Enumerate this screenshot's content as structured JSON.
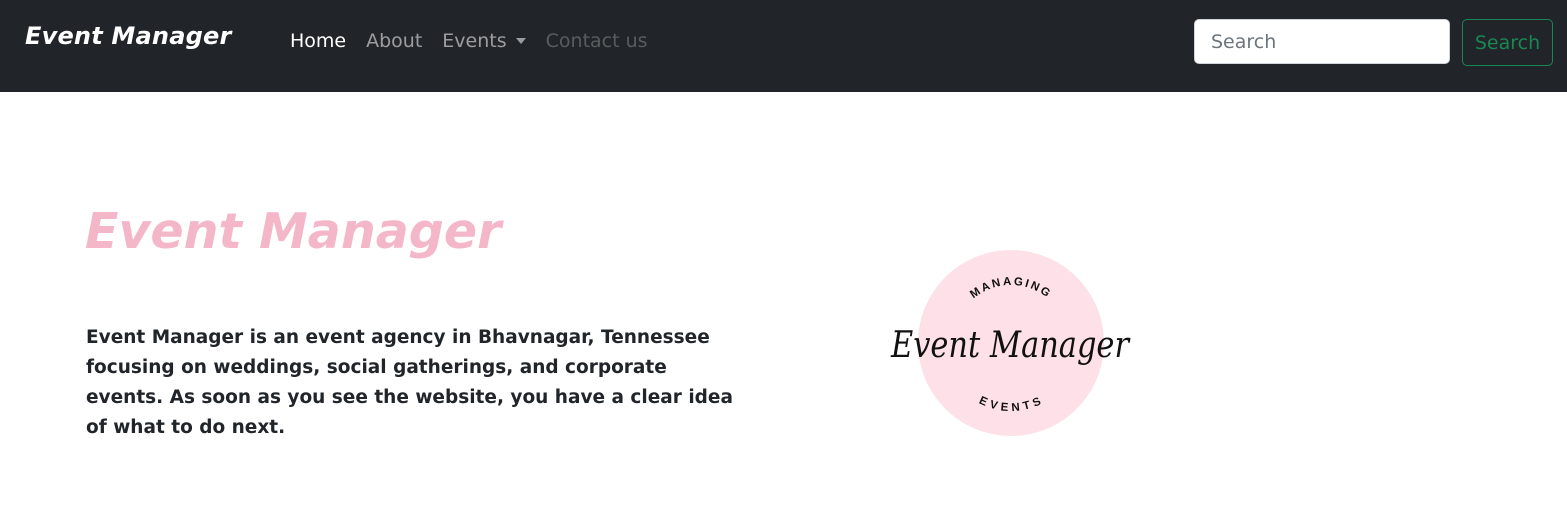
{
  "navbar": {
    "brand": "Event Manager",
    "links": [
      {
        "label": "Home"
      },
      {
        "label": "About"
      },
      {
        "label": "Events"
      },
      {
        "label": "Contact us"
      }
    ],
    "search": {
      "placeholder": "Search",
      "button_label": "Search"
    }
  },
  "hero": {
    "title": "Event Manager",
    "description": "Event Manager is an event agency in Bhavnagar, Tennessee focusing on weddings, social gatherings, and corporate events. As soon as you see the website, you have a clear idea of what to do next.",
    "logo": {
      "top_text": "MANAGING",
      "script_text": "Event Manager",
      "bottom_text": "EVENTS"
    }
  },
  "colors": {
    "navbar_bg": "#212529",
    "title_pink": "#f4b6c9",
    "logo_circle": "#fde0e8",
    "success_green": "#198754"
  }
}
